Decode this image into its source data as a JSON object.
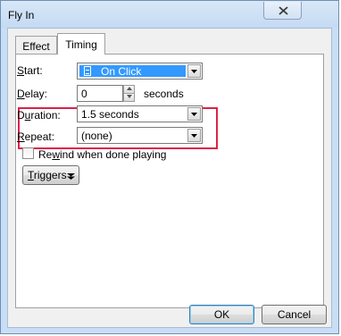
{
  "window": {
    "title": "Fly In",
    "close_glyph": "✕"
  },
  "tabs": [
    {
      "label": "Effect",
      "selected": false
    },
    {
      "label": "Timing",
      "selected": true
    }
  ],
  "fields": {
    "start": {
      "label_key": "S",
      "label_rest": "tart:",
      "value": "On Click"
    },
    "delay": {
      "label_key": "D",
      "label_rest": "elay:",
      "value": "0",
      "unit": "seconds"
    },
    "duration": {
      "label_pre": "D",
      "label_key": "u",
      "label_rest": "ration:",
      "value": "1.5 seconds"
    },
    "repeat": {
      "label_key": "R",
      "label_rest": "epeat:",
      "value": "(none)"
    },
    "rewind": {
      "label_pre": "Re",
      "label_key": "w",
      "label_rest": "ind when done playing",
      "checked": false
    }
  },
  "triggers": {
    "label_key": "T",
    "label_rest": "riggers"
  },
  "buttons": {
    "ok": "OK",
    "cancel": "Cancel"
  },
  "colors": {
    "selection": "#3399ff",
    "callout_border": "#e0204a"
  }
}
